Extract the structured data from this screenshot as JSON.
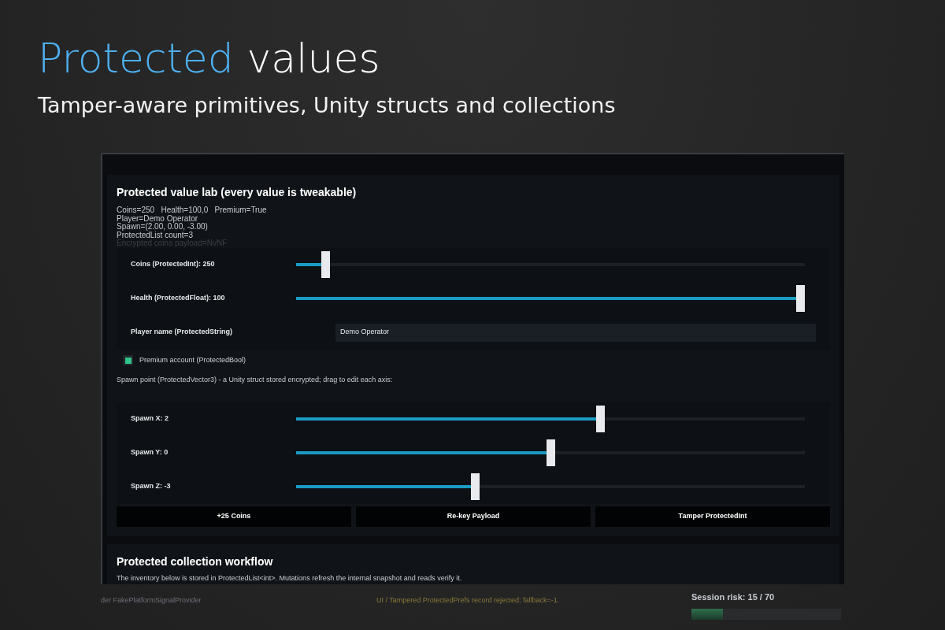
{
  "hero": {
    "title_accent": "Protected",
    "title_rest": "values",
    "subtitle": "Tamper-aware primitives, Unity structs and collections"
  },
  "lab": {
    "title": "Protected value lab (every value is tweakable)",
    "readout": [
      "Coins=250   Health=100,0   Premium=True",
      "Player=Demo Operator",
      "Spawn=(2.00, 0.00, -3.00)",
      "ProtectedList count=3"
    ],
    "faded_readout": "Encrypted coins payload=NvNF",
    "controls": [
      {
        "kind": "slider",
        "label": "Coins (ProtectedInt): 250",
        "level": 0.05
      },
      {
        "kind": "slider",
        "label": "Health (ProtectedFloat): 100",
        "level": 1.0
      },
      {
        "kind": "text",
        "label": "Player name (ProtectedString)",
        "value": "Demo Operator"
      },
      {
        "kind": "checkbox",
        "label": "Premium account (ProtectedBool)",
        "checked": true
      }
    ],
    "spawn_note": "Spawn point (ProtectedVector3) - a Unity struct stored encrypted; drag to edit each axis:",
    "axes": [
      {
        "label": "Spawn X: 2",
        "level": 0.6
      },
      {
        "label": "Spawn Y: 0",
        "level": 0.5
      },
      {
        "label": "Spawn Z: -3",
        "level": 0.35
      }
    ],
    "buttons": [
      "+25 Coins",
      "Re-key Payload",
      "Tamper ProtectedInt"
    ]
  },
  "collection": {
    "title": "Protected collection workflow",
    "description": "The inventory below is stored in ProtectedList<int>. Mutations refresh the internal snapshot and reads verify it."
  },
  "status_bar": {
    "left": "der FakePlatformSignalProvider",
    "message": "UI / Tampered ProtectedPrefs record rejected; fallback=-1.",
    "risk_label": "Session risk: 15 / 70",
    "risk_meter": {
      "level": 0.21
    }
  }
}
